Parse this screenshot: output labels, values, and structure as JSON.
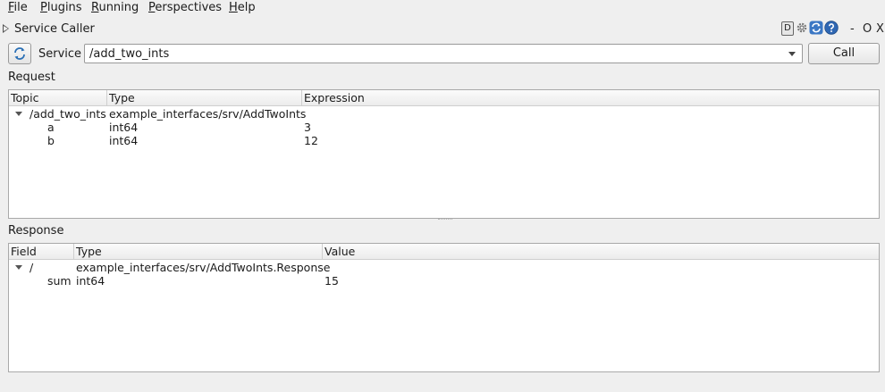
{
  "menu": [
    {
      "mnemonic": "F",
      "rest": "ile"
    },
    {
      "mnemonic": "P",
      "rest": "lugins"
    },
    {
      "mnemonic": "R",
      "rest": "unning"
    },
    {
      "mnemonic": "P",
      "rest": "erspectives"
    },
    {
      "mnemonic": "H",
      "rest": "elp"
    }
  ],
  "plugin": {
    "title": "Service Caller",
    "d_label": "D",
    "minimize": "-",
    "float": "O",
    "close": "X"
  },
  "toolbar": {
    "service_label": "Service",
    "service_value": "/add_two_ints",
    "call_label": "Call"
  },
  "request": {
    "label": "Request",
    "columns": [
      "Topic",
      "Type",
      "Expression"
    ],
    "root": {
      "topic": "/add_two_ints",
      "type": "example_interfaces/srv/AddTwoInts",
      "expression": ""
    },
    "rows": [
      {
        "topic": "a",
        "type": "int64",
        "expression": "3"
      },
      {
        "topic": "b",
        "type": "int64",
        "expression": "12"
      }
    ]
  },
  "response": {
    "label": "Response",
    "columns": [
      "Field",
      "Type",
      "Value"
    ],
    "root": {
      "field": "/",
      "type": "example_interfaces/srv/AddTwoInts.Response",
      "value": ""
    },
    "rows": [
      {
        "field": "sum",
        "type": "int64",
        "value": "15"
      }
    ]
  },
  "colors": {
    "background": "#efefef",
    "accent": "#2a6fb5"
  },
  "icons": [
    "tri-icon",
    "gear-icon",
    "reload-icon",
    "help-icon",
    "refresh-icon",
    "chevron-down-icon",
    "expand-arrow-icon"
  ]
}
